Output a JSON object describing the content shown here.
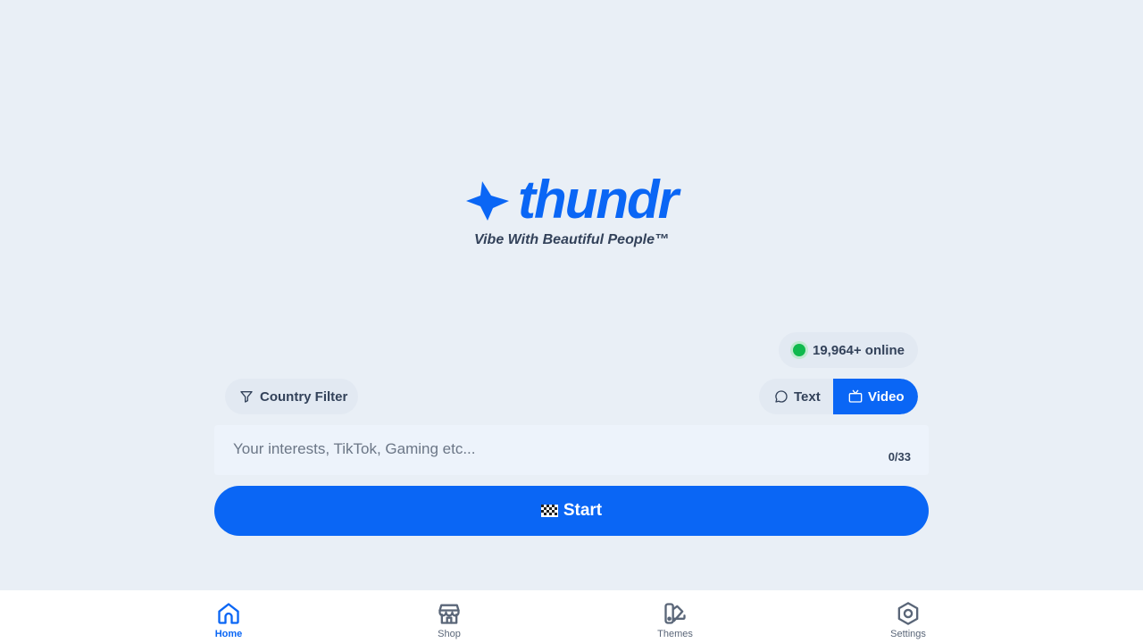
{
  "brand": {
    "name": "thundr",
    "tagline": "Vibe With Beautiful People™",
    "color": "#0a66f5"
  },
  "online": {
    "count_text": "19,964+ online",
    "status_color": "#10b94d"
  },
  "filters": {
    "country_label": "Country Filter"
  },
  "mode": {
    "options": [
      {
        "label": "Text",
        "icon": "chat-bubble-icon",
        "selected": false
      },
      {
        "label": "Video",
        "icon": "tv-icon",
        "selected": true
      }
    ]
  },
  "interests": {
    "placeholder": "Your interests, TikTok, Gaming etc...",
    "value": "",
    "counter": "0/33"
  },
  "start": {
    "label": "Start",
    "icon": "checkered-flag-icon"
  },
  "nav": {
    "items": [
      {
        "label": "Home",
        "icon": "home-icon",
        "active": true
      },
      {
        "label": "Shop",
        "icon": "shop-icon",
        "active": false
      },
      {
        "label": "Themes",
        "icon": "themes-icon",
        "active": false
      },
      {
        "label": "Settings",
        "icon": "settings-icon",
        "active": false
      }
    ]
  }
}
